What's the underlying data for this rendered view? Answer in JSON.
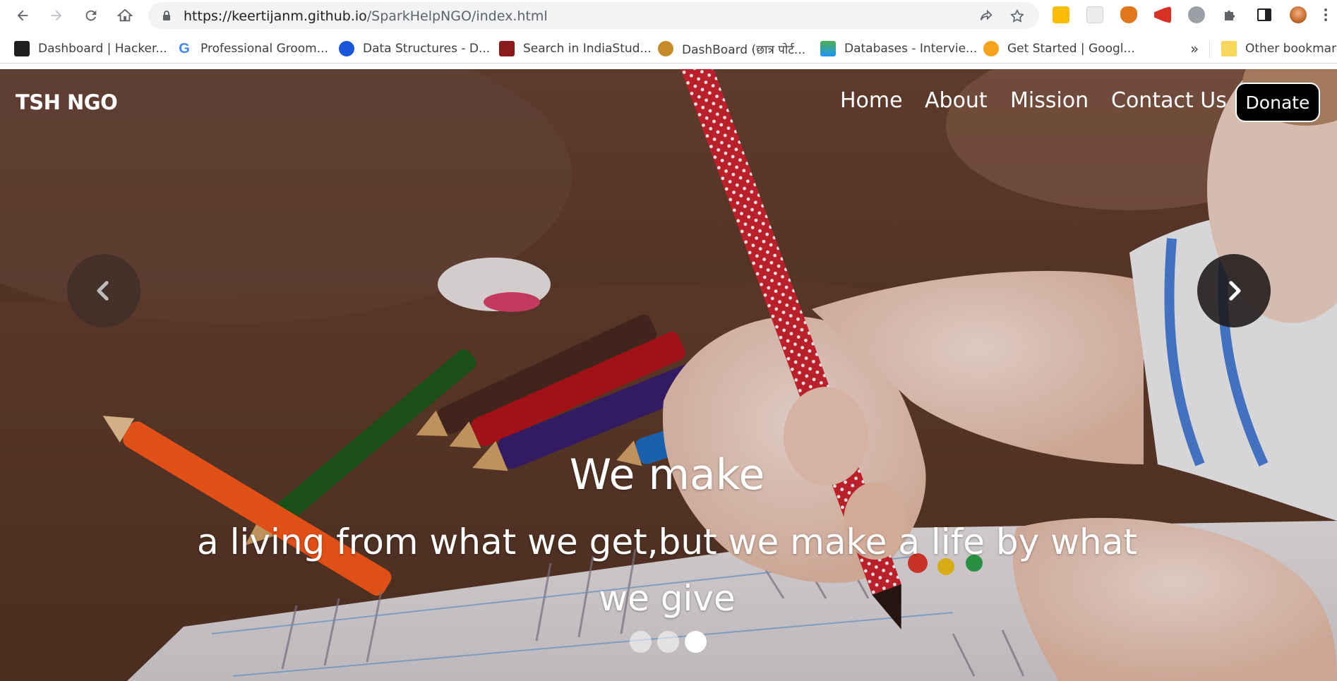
{
  "browser": {
    "url_host": "https://keertijanm.github.io",
    "url_path": "/SparkHelpNGO/index.html",
    "extensions": [
      {
        "name": "keep-icon",
        "color": "#fbbc04"
      },
      {
        "name": "extension-grid-icon",
        "color": "#dadce0"
      },
      {
        "name": "metamask-icon",
        "color": "#e2761b"
      },
      {
        "name": "megaphone-icon",
        "color": "#d93025"
      },
      {
        "name": "bug-icon",
        "color": "#9aa0a6"
      },
      {
        "name": "puzzle-icon",
        "color": "#5f6368"
      },
      {
        "name": "side-panel-icon",
        "color": "#5f6368"
      },
      {
        "name": "profile-avatar",
        "color": "#f4b183"
      }
    ]
  },
  "bookmarks": [
    {
      "label": "Dashboard | Hacker...",
      "icon": "hackerrank-icon",
      "color": "#1f1f1f"
    },
    {
      "label": "Professional Groom...",
      "icon": "google-g-icon",
      "color": "#4285f4"
    },
    {
      "label": "Data Structures - D...",
      "icon": "codechef-c-icon",
      "color": "#1a56db"
    },
    {
      "label": "Search in IndiaStud...",
      "icon": "book-icon",
      "color": "#8b1a1a"
    },
    {
      "label": "DashBoard (छात्र पोर्ट...",
      "icon": "emblem-icon",
      "color": "#c58b2a"
    },
    {
      "label": "Databases - Intervie...",
      "icon": "stack-icon",
      "color": "#4caf50"
    },
    {
      "label": "Get Started | Googl...",
      "icon": "gear-badge-icon",
      "color": "#f6a21a"
    }
  ],
  "bookmarks_overflow": "»",
  "other_bookmarks": "Other bookmarks",
  "site": {
    "brand": "TSH NGO",
    "nav": [
      "Home",
      "About",
      "Mission",
      "Contact Us"
    ],
    "donate": "Donate"
  },
  "carousel": {
    "heading": "We make",
    "subheading": "a living from what we get,but we make a life by what we give",
    "slides_count": 3,
    "active_slide": 3
  }
}
